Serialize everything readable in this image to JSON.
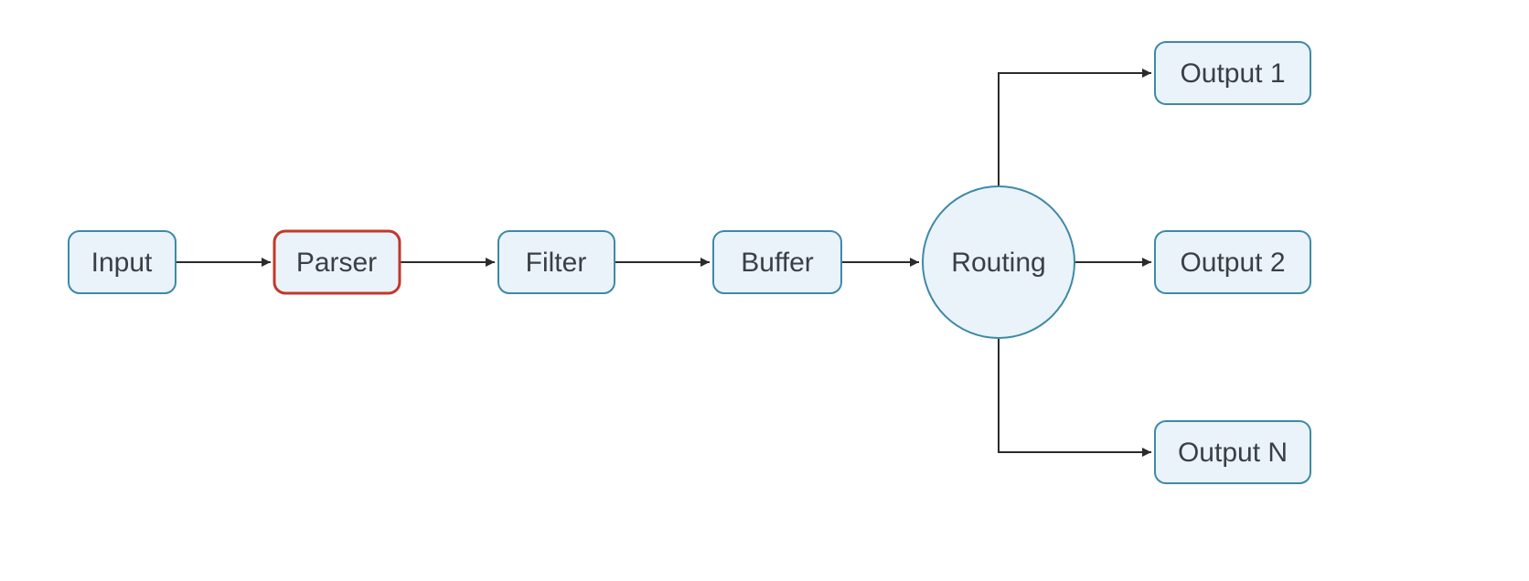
{
  "diagram": {
    "nodes": {
      "input": {
        "label": "Input",
        "shape": "rect",
        "highlight": false
      },
      "parser": {
        "label": "Parser",
        "shape": "rect",
        "highlight": true
      },
      "filter": {
        "label": "Filter",
        "shape": "rect",
        "highlight": false
      },
      "buffer": {
        "label": "Buffer",
        "shape": "rect",
        "highlight": false
      },
      "routing": {
        "label": "Routing",
        "shape": "circle",
        "highlight": false
      },
      "output1": {
        "label": "Output 1",
        "shape": "rect",
        "highlight": false
      },
      "output2": {
        "label": "Output 2",
        "shape": "rect",
        "highlight": false
      },
      "outputN": {
        "label": "Output N",
        "shape": "rect",
        "highlight": false
      }
    },
    "edges": [
      {
        "from": "input",
        "to": "parser"
      },
      {
        "from": "parser",
        "to": "filter"
      },
      {
        "from": "filter",
        "to": "buffer"
      },
      {
        "from": "buffer",
        "to": "routing"
      },
      {
        "from": "routing",
        "to": "output1"
      },
      {
        "from": "routing",
        "to": "output2"
      },
      {
        "from": "routing",
        "to": "outputN"
      }
    ],
    "colors": {
      "node_fill": "#eaf3fa",
      "node_stroke": "#3e89a6",
      "highlight_stroke": "#c0392b",
      "edge": "#2b2b2b",
      "text": "#3a3f44"
    }
  }
}
